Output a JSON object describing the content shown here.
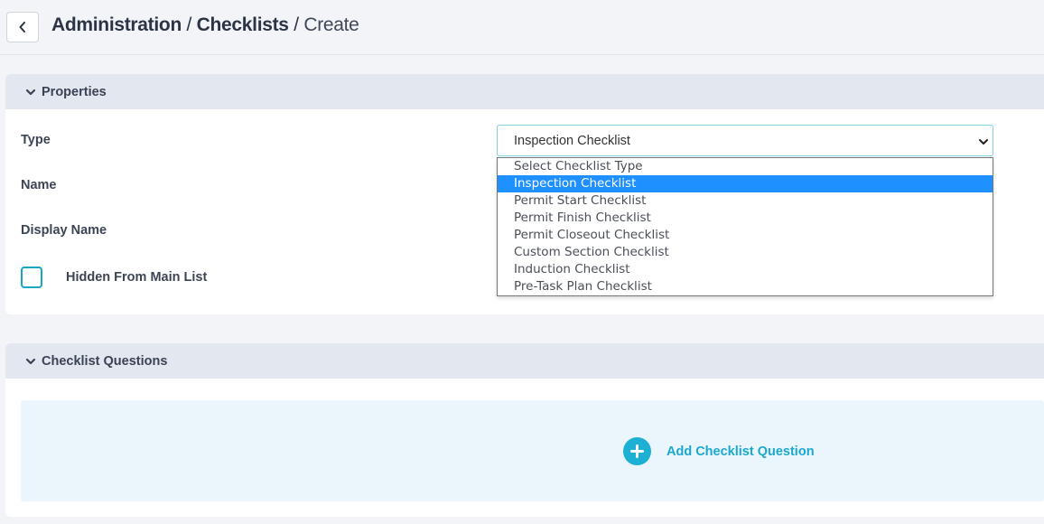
{
  "header": {
    "breadcrumb": [
      {
        "label": "Administration",
        "strong": true
      },
      {
        "label": "Checklists",
        "strong": true
      },
      {
        "label": "Create",
        "strong": false
      }
    ],
    "separator": "/"
  },
  "icons": {
    "back": "chevron-left-icon",
    "collapse": "chevron-down-icon",
    "select_arrow": "chevron-down-icon",
    "add": "plus-circle-icon"
  },
  "colors": {
    "accent": "#1cb0d4",
    "dropdown_selected": "#1e90ff",
    "panel_header_bg": "#e2e7f0"
  },
  "properties": {
    "title": "Properties",
    "fields": {
      "type_label": "Type",
      "name_label": "Name",
      "display_name_label": "Display Name"
    },
    "type_select": {
      "value": "Inspection Checklist",
      "options": [
        "Select Checklist Type",
        "Inspection Checklist",
        "Permit Start Checklist",
        "Permit Finish Checklist",
        "Permit Closeout Checklist",
        "Custom Section Checklist",
        "Induction Checklist",
        "Pre-Task Plan Checklist"
      ],
      "selected_index": 1
    },
    "hidden_checkbox": {
      "label": "Hidden From Main List",
      "checked": false
    }
  },
  "questions": {
    "title": "Checklist Questions",
    "add_label": "Add Checklist Question"
  }
}
